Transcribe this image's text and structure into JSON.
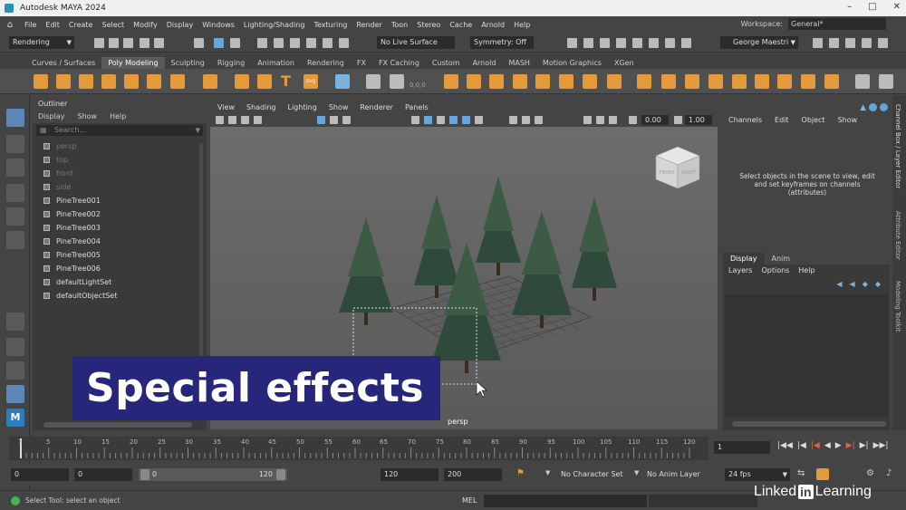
{
  "window": {
    "title": "Autodesk MAYA 2024"
  },
  "menubar": {
    "items": [
      "File",
      "Edit",
      "Create",
      "Select",
      "Modify",
      "Display",
      "Windows",
      "Lighting/Shading",
      "Texturing",
      "Render",
      "Toon",
      "Stereo",
      "Cache",
      "Arnold",
      "Help"
    ],
    "workspace_label": "Workspace:",
    "workspace_value": "General*"
  },
  "statusline": {
    "menuset": "Rendering",
    "live_surface": "No Live Surface",
    "symmetry": "Symmetry: Off",
    "user": "George Maestri"
  },
  "shelf": {
    "tabs": [
      "Curves / Surfaces",
      "Poly Modeling",
      "Sculpting",
      "Rigging",
      "Animation",
      "Rendering",
      "FX",
      "FX Caching",
      "Custom",
      "Arnold",
      "MASH",
      "Motion Graphics",
      "XGen"
    ],
    "active": "Poly Modeling",
    "svg_label": "svg",
    "counter": "0,0,0"
  },
  "outliner": {
    "title": "Outliner",
    "menus": [
      "Display",
      "Show",
      "Help"
    ],
    "search_placeholder": "Search...",
    "items": [
      {
        "label": "persp",
        "dim": true
      },
      {
        "label": "top",
        "dim": true
      },
      {
        "label": "front",
        "dim": true
      },
      {
        "label": "side",
        "dim": true
      },
      {
        "label": "PineTree001",
        "dim": false
      },
      {
        "label": "PineTree002",
        "dim": false
      },
      {
        "label": "PineTree003",
        "dim": false
      },
      {
        "label": "PineTree004",
        "dim": false
      },
      {
        "label": "PineTree005",
        "dim": false
      },
      {
        "label": "PineTree006",
        "dim": false
      },
      {
        "label": "defaultLightSet",
        "dim": false
      },
      {
        "label": "defaultObjectSet",
        "dim": false
      }
    ]
  },
  "viewport": {
    "menus": [
      "View",
      "Shading",
      "Lighting",
      "Show",
      "Renderer",
      "Panels"
    ],
    "camera_label": "persp",
    "field_a": "0.00",
    "field_b": "1.00",
    "viewcube_front": "FRONT",
    "viewcube_right": "RIGHT"
  },
  "channelbox": {
    "menus": [
      "Channels",
      "Edit",
      "Object",
      "Show"
    ],
    "hint": "Select objects in the scene to view, edit and set keyframes on channels (attributes)",
    "layer_tabs": [
      "Display",
      "Anim"
    ],
    "layer_menus": [
      "Layers",
      "Options",
      "Help"
    ]
  },
  "sidebar_tabs": [
    "Channel Box / Layer Editor",
    "Attribute Editor",
    "Modeling Toolkit"
  ],
  "timeslider": {
    "ticks": [
      "1",
      "5",
      "10",
      "15",
      "20",
      "25",
      "30",
      "35",
      "40",
      "45",
      "50",
      "55",
      "60",
      "65",
      "70",
      "75",
      "80",
      "85",
      "90",
      "95",
      "100",
      "105",
      "110",
      "115",
      "120"
    ],
    "current_frame": "1"
  },
  "range": {
    "start": "0",
    "start2": "0",
    "slider_min": "0",
    "slider_max": "120",
    "end": "120",
    "end2": "200",
    "character_set": "No Character Set",
    "anim_layer": "No Anim Layer",
    "fps": "24 fps"
  },
  "helpline": {
    "text": "Select Tool: select an object",
    "mel_label": "MEL"
  },
  "overlay": {
    "banner": "Special effects",
    "brand_left": "Linked",
    "brand_in": "in",
    "brand_right": "Learning"
  },
  "colors": {
    "banner_bg": "#26267a",
    "accent_orange": "#e59a3a",
    "selection_blue": "#5c88b8"
  }
}
